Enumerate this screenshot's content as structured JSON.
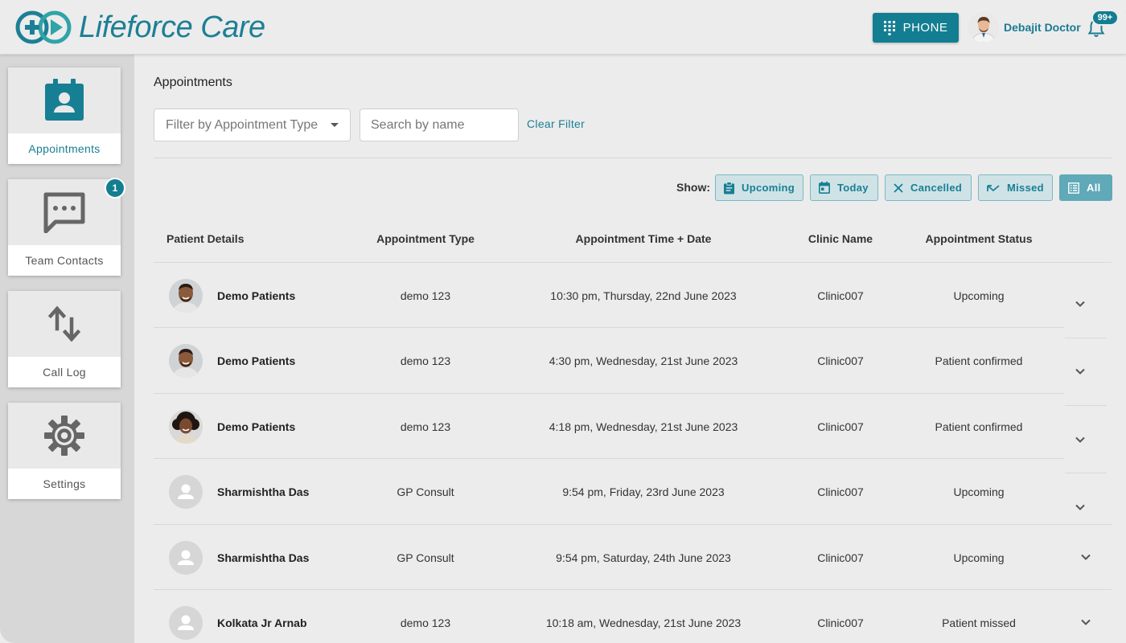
{
  "header": {
    "brand": "Lifeforce Care",
    "phone_label": "PHONE",
    "user_name": "Debajit Doctor",
    "notifications_badge": "99+"
  },
  "sidebar": {
    "items": [
      {
        "label": "Appointments",
        "icon": "calendar-user-icon",
        "active": true
      },
      {
        "label": "Team Contacts",
        "icon": "chat-bubble-icon",
        "badge": "1"
      },
      {
        "label": "Call Log",
        "icon": "swap-vertical-icon"
      },
      {
        "label": "Settings",
        "icon": "gear-icon"
      }
    ]
  },
  "main": {
    "title": "Appointments",
    "filter_placeholder": "Filter by Appointment Type",
    "search_placeholder": "Search by name",
    "clear_filter": "Clear Filter",
    "show_label": "Show:",
    "chips": [
      {
        "label": "Upcoming",
        "icon": "clipboard-icon",
        "active": false
      },
      {
        "label": "Today",
        "icon": "calendar-today-icon",
        "active": false
      },
      {
        "label": "Cancelled",
        "icon": "close-icon",
        "active": false
      },
      {
        "label": "Missed",
        "icon": "missed-call-icon",
        "active": false
      },
      {
        "label": "All",
        "icon": "list-icon",
        "active": true
      }
    ]
  },
  "table": {
    "columns": [
      "Patient Details",
      "Appointment Type",
      "Appointment Time + Date",
      "Clinic Name",
      "Appointment Status"
    ],
    "rows": [
      {
        "name": "Demo Patients",
        "type": "demo 123",
        "datetime": "10:30 pm, Thursday, 22nd June 2023",
        "clinic": "Clinic007",
        "status": "Upcoming",
        "avatar": "photo-man"
      },
      {
        "name": "Demo Patients",
        "type": "demo 123",
        "datetime": "4:30 pm, Wednesday, 21st June 2023",
        "clinic": "Clinic007",
        "status": "Patient confirmed",
        "avatar": "photo-man"
      },
      {
        "name": "Demo Patients",
        "type": "demo 123",
        "datetime": "4:18 pm, Wednesday, 21st June 2023",
        "clinic": "Clinic007",
        "status": "Patient confirmed",
        "avatar": "photo-woman"
      },
      {
        "name": "Sharmishtha Das",
        "type": "GP Consult",
        "datetime": "9:54 pm, Friday, 23rd June 2023",
        "clinic": "Clinic007",
        "status": "Upcoming",
        "avatar": "placeholder"
      },
      {
        "name": "Sharmishtha Das",
        "type": "GP Consult",
        "datetime": "9:54 pm, Saturday, 24th June 2023",
        "clinic": "Clinic007",
        "status": "Upcoming",
        "avatar": "placeholder"
      },
      {
        "name": "Kolkata Jr Arnab",
        "type": "demo 123",
        "datetime": "10:18 am, Wednesday, 21st June 2023",
        "clinic": "Clinic007",
        "status": "Patient missed",
        "avatar": "placeholder"
      }
    ]
  },
  "colors": {
    "primary": "#137e91",
    "chip_bg": "#cfe3e7",
    "chip_active": "#5fa9b8",
    "sidebar_bg": "#d7d7d7",
    "page_bg": "#ececec"
  }
}
